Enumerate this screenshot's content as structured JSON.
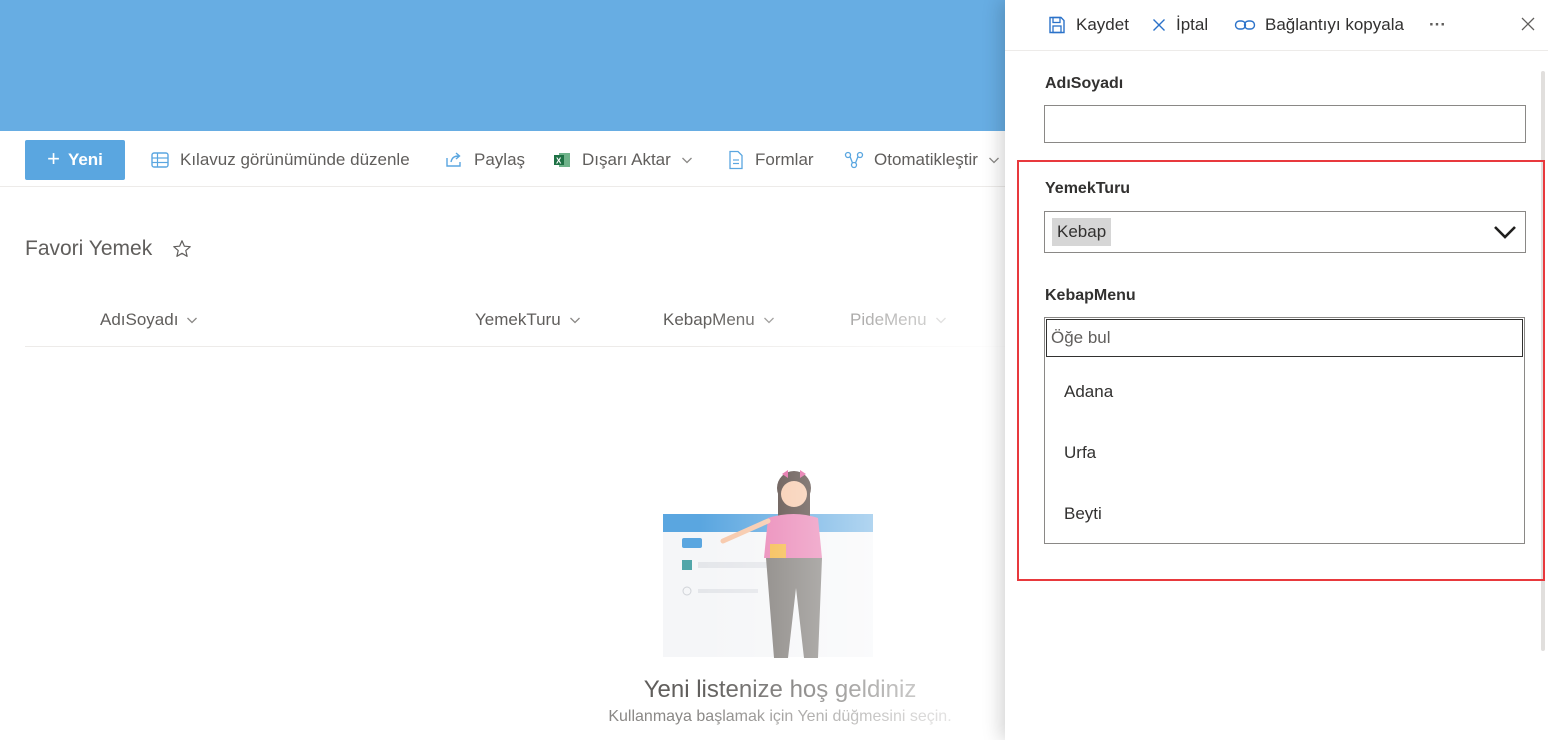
{
  "commandbar": {
    "new_label": "Yeni",
    "grid_edit": "Kılavuz görünümünde düzenle",
    "share": "Paylaş",
    "export": "Dışarı Aktar",
    "forms": "Formlar",
    "automate": "Otomatikleştir"
  },
  "list": {
    "title": "Favori Yemek",
    "columns": [
      "AdıSoyadı",
      "YemekTuru",
      "KebapMenu",
      "PideMenu"
    ],
    "empty_title": "Yeni listenize hoş geldiniz",
    "empty_sub": "Kullanmaya başlamak için Yeni düğmesini seçin."
  },
  "panel": {
    "toolbar": {
      "save": "Kaydet",
      "cancel": "İptal",
      "copy_link": "Bağlantıyı kopyala",
      "more": "···"
    },
    "fields": {
      "adisoyadi_label": "AdıSoyadı",
      "adisoyadi_value": "",
      "yemekturu_label": "YemekTuru",
      "yemekturu_value": "Kebap",
      "kebapmenu_label": "KebapMenu",
      "search_placeholder": "Öğe bul",
      "options": [
        "Adana",
        "Urfa",
        "Beyti"
      ]
    }
  },
  "colors": {
    "banner": "#67ade3",
    "primary_button": "#5aa6e0",
    "highlight_border": "#e8393d"
  }
}
